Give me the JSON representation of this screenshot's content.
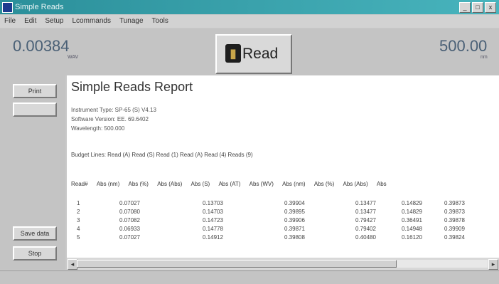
{
  "window": {
    "title": "Simple Reads",
    "buttons": [
      "_",
      "□",
      "x"
    ]
  },
  "menu": [
    "File",
    "Edit",
    "Setup",
    "Lcommands",
    "Tunage",
    "Tools"
  ],
  "readouts": {
    "left_value": "0.00384",
    "left_unit": "WAV",
    "right_value": "500.00",
    "right_unit": "nm"
  },
  "read_button": {
    "label": "Read",
    "icon": "read-icon"
  },
  "sidebar": {
    "top_buttons": [
      "Print",
      ""
    ],
    "bottom_buttons": [
      "Save data",
      "Stop"
    ]
  },
  "report": {
    "title": "Simple Reads Report",
    "meta": [
      "Instrument Type:  SP-65 (S) V4.13",
      "Software Version:  EE. 69.6402",
      "Wavelength:        500.000"
    ],
    "budget_line": "Budget Lines:  Read (A) Read (S) Read (1) Read (A) Read (4) Reads (9)",
    "columns": [
      "Read#",
      "Abs (nm)",
      "Abs (%)",
      "Abs (Abs)",
      "Abs (S)",
      "Abs (AT)",
      "Abs (WV)",
      "Abs (nm)",
      "Abs (%)",
      "Abs (Abs)",
      "Abs"
    ],
    "rows": [
      [
        "1",
        "0.07027",
        "0.13703",
        "0.39904",
        "0.13477",
        "0.14829",
        "0.39873"
      ],
      [
        "2",
        "0.07080",
        "0.14703",
        "0.39895",
        "0.13477",
        "0.14829",
        "0.39873"
      ],
      [
        "3",
        "0.07082",
        "0.14723",
        "0.39906",
        "0.79427",
        "0.36491",
        "0.39878"
      ],
      [
        "4",
        "0.06933",
        "0.14778",
        "0.39871",
        "0.79402",
        "0.14948",
        "0.39909"
      ],
      [
        "5",
        "0.07027",
        "0.14912",
        "0.39808",
        "0.40480",
        "0.16120",
        "0.39824"
      ]
    ]
  },
  "scrollbar": {
    "left_arrow": "◂",
    "right_arrow": "▸"
  }
}
